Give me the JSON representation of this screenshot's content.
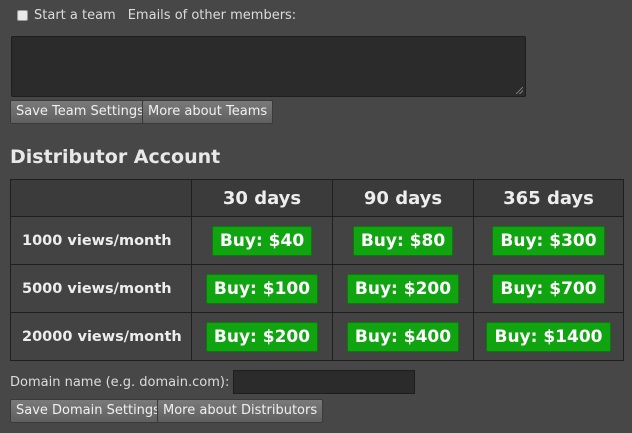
{
  "team": {
    "start_label": "Start a team",
    "emails_label": "Emails of other members:",
    "emails_value": "",
    "save_button": "Save Team Settings",
    "more_button": "More about Teams"
  },
  "distributor": {
    "title": "Distributor Account",
    "columns": [
      "30 days",
      "90 days",
      "365 days"
    ],
    "rows": [
      {
        "label": "1000 views/month",
        "prices": [
          "Buy: $40",
          "Buy: $80",
          "Buy: $300"
        ]
      },
      {
        "label": "5000 views/month",
        "prices": [
          "Buy: $100",
          "Buy: $200",
          "Buy: $700"
        ]
      },
      {
        "label": "20000 views/month",
        "prices": [
          "Buy: $200",
          "Buy: $400",
          "Buy: $1400"
        ]
      }
    ],
    "domain_label": "Domain name (e.g. domain.com):",
    "domain_value": "",
    "save_button": "Save Domain Settings",
    "more_button": "More about Distributors"
  },
  "colors": {
    "buy_green": "#11a411",
    "background": "#474747"
  }
}
